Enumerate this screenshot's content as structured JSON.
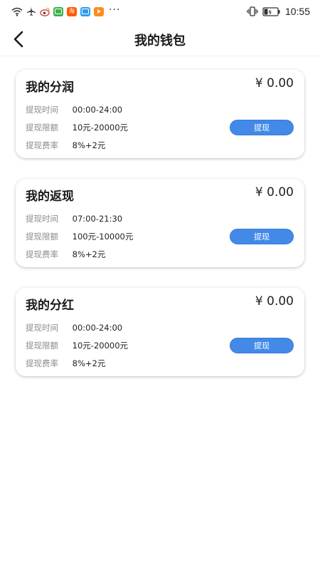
{
  "status_bar": {
    "app_icons": [
      {
        "name": "message-app-icon",
        "color": "#3cb04a",
        "glyph": ""
      },
      {
        "name": "taobao-app-icon",
        "color": "#ff5a00",
        "glyph": "淘"
      },
      {
        "name": "tv-app-icon",
        "color": "#2d9cf0",
        "glyph": ""
      },
      {
        "name": "video-app-icon",
        "color": "#ff8a1c",
        "glyph": ""
      }
    ],
    "more": "···",
    "time": "10:55"
  },
  "nav": {
    "back_icon": "chevron-left-icon",
    "title": "我的钱包"
  },
  "labels": {
    "time": "提现时间",
    "limit": "提现限额",
    "fee": "提现费率",
    "withdraw_button": "提现"
  },
  "cards": [
    {
      "title": "我的分润",
      "amount": "¥ 0.00",
      "time": "00:00-24:00",
      "limit": "10元-20000元",
      "fee": "8%+2元"
    },
    {
      "title": "我的返现",
      "amount": "¥ 0.00",
      "time": "07:00-21:30",
      "limit": "100元-10000元",
      "fee": "8%+2元"
    },
    {
      "title": "我的分红",
      "amount": "¥ 0.00",
      "time": "00:00-24:00",
      "limit": "10元-20000元",
      "fee": "8%+2元"
    }
  ],
  "colors": {
    "accent": "#4289e8",
    "label_gray": "#8c8c8c"
  }
}
